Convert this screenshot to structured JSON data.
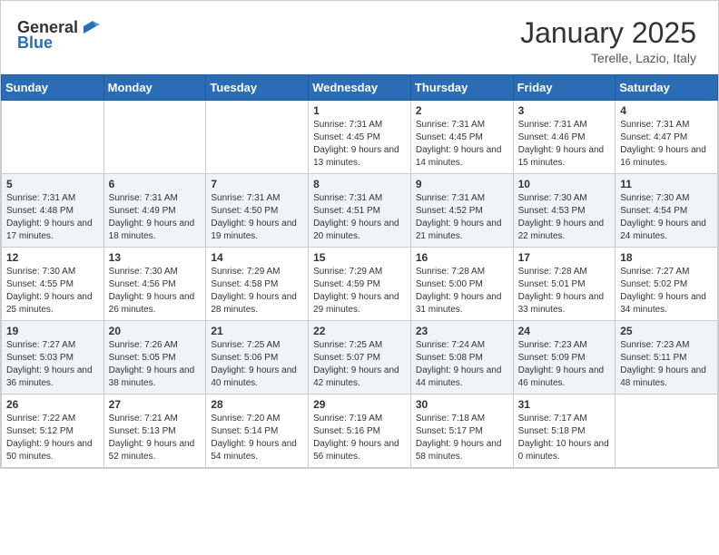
{
  "header": {
    "logo_general": "General",
    "logo_blue": "Blue",
    "month": "January 2025",
    "location": "Terelle, Lazio, Italy"
  },
  "weekdays": [
    "Sunday",
    "Monday",
    "Tuesday",
    "Wednesday",
    "Thursday",
    "Friday",
    "Saturday"
  ],
  "weeks": [
    [
      {
        "day": "",
        "sunrise": "",
        "sunset": "",
        "daylight": ""
      },
      {
        "day": "",
        "sunrise": "",
        "sunset": "",
        "daylight": ""
      },
      {
        "day": "",
        "sunrise": "",
        "sunset": "",
        "daylight": ""
      },
      {
        "day": "1",
        "sunrise": "Sunrise: 7:31 AM",
        "sunset": "Sunset: 4:45 PM",
        "daylight": "Daylight: 9 hours and 13 minutes."
      },
      {
        "day": "2",
        "sunrise": "Sunrise: 7:31 AM",
        "sunset": "Sunset: 4:45 PM",
        "daylight": "Daylight: 9 hours and 14 minutes."
      },
      {
        "day": "3",
        "sunrise": "Sunrise: 7:31 AM",
        "sunset": "Sunset: 4:46 PM",
        "daylight": "Daylight: 9 hours and 15 minutes."
      },
      {
        "day": "4",
        "sunrise": "Sunrise: 7:31 AM",
        "sunset": "Sunset: 4:47 PM",
        "daylight": "Daylight: 9 hours and 16 minutes."
      }
    ],
    [
      {
        "day": "5",
        "sunrise": "Sunrise: 7:31 AM",
        "sunset": "Sunset: 4:48 PM",
        "daylight": "Daylight: 9 hours and 17 minutes."
      },
      {
        "day": "6",
        "sunrise": "Sunrise: 7:31 AM",
        "sunset": "Sunset: 4:49 PM",
        "daylight": "Daylight: 9 hours and 18 minutes."
      },
      {
        "day": "7",
        "sunrise": "Sunrise: 7:31 AM",
        "sunset": "Sunset: 4:50 PM",
        "daylight": "Daylight: 9 hours and 19 minutes."
      },
      {
        "day": "8",
        "sunrise": "Sunrise: 7:31 AM",
        "sunset": "Sunset: 4:51 PM",
        "daylight": "Daylight: 9 hours and 20 minutes."
      },
      {
        "day": "9",
        "sunrise": "Sunrise: 7:31 AM",
        "sunset": "Sunset: 4:52 PM",
        "daylight": "Daylight: 9 hours and 21 minutes."
      },
      {
        "day": "10",
        "sunrise": "Sunrise: 7:30 AM",
        "sunset": "Sunset: 4:53 PM",
        "daylight": "Daylight: 9 hours and 22 minutes."
      },
      {
        "day": "11",
        "sunrise": "Sunrise: 7:30 AM",
        "sunset": "Sunset: 4:54 PM",
        "daylight": "Daylight: 9 hours and 24 minutes."
      }
    ],
    [
      {
        "day": "12",
        "sunrise": "Sunrise: 7:30 AM",
        "sunset": "Sunset: 4:55 PM",
        "daylight": "Daylight: 9 hours and 25 minutes."
      },
      {
        "day": "13",
        "sunrise": "Sunrise: 7:30 AM",
        "sunset": "Sunset: 4:56 PM",
        "daylight": "Daylight: 9 hours and 26 minutes."
      },
      {
        "day": "14",
        "sunrise": "Sunrise: 7:29 AM",
        "sunset": "Sunset: 4:58 PM",
        "daylight": "Daylight: 9 hours and 28 minutes."
      },
      {
        "day": "15",
        "sunrise": "Sunrise: 7:29 AM",
        "sunset": "Sunset: 4:59 PM",
        "daylight": "Daylight: 9 hours and 29 minutes."
      },
      {
        "day": "16",
        "sunrise": "Sunrise: 7:28 AM",
        "sunset": "Sunset: 5:00 PM",
        "daylight": "Daylight: 9 hours and 31 minutes."
      },
      {
        "day": "17",
        "sunrise": "Sunrise: 7:28 AM",
        "sunset": "Sunset: 5:01 PM",
        "daylight": "Daylight: 9 hours and 33 minutes."
      },
      {
        "day": "18",
        "sunrise": "Sunrise: 7:27 AM",
        "sunset": "Sunset: 5:02 PM",
        "daylight": "Daylight: 9 hours and 34 minutes."
      }
    ],
    [
      {
        "day": "19",
        "sunrise": "Sunrise: 7:27 AM",
        "sunset": "Sunset: 5:03 PM",
        "daylight": "Daylight: 9 hours and 36 minutes."
      },
      {
        "day": "20",
        "sunrise": "Sunrise: 7:26 AM",
        "sunset": "Sunset: 5:05 PM",
        "daylight": "Daylight: 9 hours and 38 minutes."
      },
      {
        "day": "21",
        "sunrise": "Sunrise: 7:25 AM",
        "sunset": "Sunset: 5:06 PM",
        "daylight": "Daylight: 9 hours and 40 minutes."
      },
      {
        "day": "22",
        "sunrise": "Sunrise: 7:25 AM",
        "sunset": "Sunset: 5:07 PM",
        "daylight": "Daylight: 9 hours and 42 minutes."
      },
      {
        "day": "23",
        "sunrise": "Sunrise: 7:24 AM",
        "sunset": "Sunset: 5:08 PM",
        "daylight": "Daylight: 9 hours and 44 minutes."
      },
      {
        "day": "24",
        "sunrise": "Sunrise: 7:23 AM",
        "sunset": "Sunset: 5:09 PM",
        "daylight": "Daylight: 9 hours and 46 minutes."
      },
      {
        "day": "25",
        "sunrise": "Sunrise: 7:23 AM",
        "sunset": "Sunset: 5:11 PM",
        "daylight": "Daylight: 9 hours and 48 minutes."
      }
    ],
    [
      {
        "day": "26",
        "sunrise": "Sunrise: 7:22 AM",
        "sunset": "Sunset: 5:12 PM",
        "daylight": "Daylight: 9 hours and 50 minutes."
      },
      {
        "day": "27",
        "sunrise": "Sunrise: 7:21 AM",
        "sunset": "Sunset: 5:13 PM",
        "daylight": "Daylight: 9 hours and 52 minutes."
      },
      {
        "day": "28",
        "sunrise": "Sunrise: 7:20 AM",
        "sunset": "Sunset: 5:14 PM",
        "daylight": "Daylight: 9 hours and 54 minutes."
      },
      {
        "day": "29",
        "sunrise": "Sunrise: 7:19 AM",
        "sunset": "Sunset: 5:16 PM",
        "daylight": "Daylight: 9 hours and 56 minutes."
      },
      {
        "day": "30",
        "sunrise": "Sunrise: 7:18 AM",
        "sunset": "Sunset: 5:17 PM",
        "daylight": "Daylight: 9 hours and 58 minutes."
      },
      {
        "day": "31",
        "sunrise": "Sunrise: 7:17 AM",
        "sunset": "Sunset: 5:18 PM",
        "daylight": "Daylight: 10 hours and 0 minutes."
      },
      {
        "day": "",
        "sunrise": "",
        "sunset": "",
        "daylight": ""
      }
    ]
  ]
}
